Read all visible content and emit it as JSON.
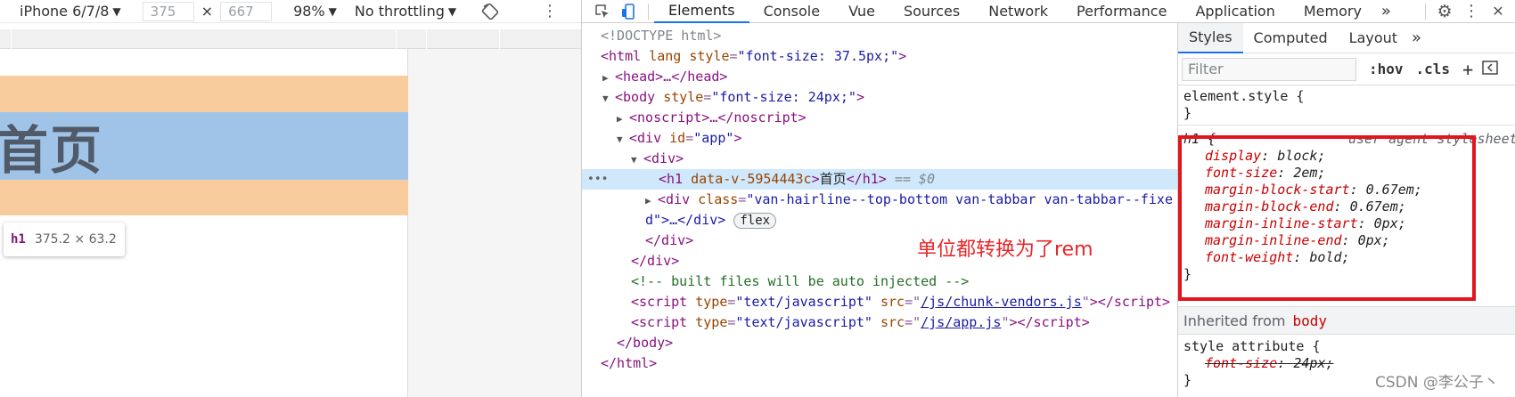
{
  "device_toolbar": {
    "device": "iPhone 6/7/8",
    "width": "375",
    "height": "667",
    "times": "×",
    "zoom": "98%",
    "throttling": "No throttling"
  },
  "viewport": {
    "h1_text": "首页",
    "tooltip_tag": "h1",
    "tooltip_size": "375.2 × 63.2"
  },
  "devtools_tabs": [
    "Elements",
    "Console",
    "Vue",
    "Sources",
    "Network",
    "Performance",
    "Application",
    "Memory"
  ],
  "devtools_more": "»",
  "tree": {
    "doctype": "<!DOCTYPE html>",
    "html_open": "<html",
    "html_attr_lang": "lang",
    "html_attr_style": "style",
    "html_style_val": "\"font-size: 37.5px;\"",
    "head": "<head>…</head>",
    "body_open": "<body",
    "body_attr_style": "style",
    "body_style_val": "\"font-size: 24px;\"",
    "noscript": "<noscript>…</noscript>",
    "div_app_open": "<div",
    "div_app_attr": "id",
    "div_app_val": "\"app\"",
    "div_inner": "<div>",
    "h1_open": "<h1",
    "h1_attr": "data-v-5954443c",
    "h1_text": "首页",
    "h1_close": "</h1>",
    "h1_eq": "== $0",
    "tabbar_open": "<div",
    "tabbar_attr": "class",
    "tabbar_val": "\"van-hairline--top-bottom van-tabbar van-tabbar--fixe",
    "tabbar_cont": "d\">…</div>",
    "tabbar_badge": "flex",
    "div_close1": "</div>",
    "div_close2": "</div>",
    "comment": "<!-- built files will be auto injected -->",
    "script1_src": "/js/chunk-vendors.js",
    "script2_src": "/js/app.js",
    "script_attr_type": "type",
    "script_type_val": "\"text/javascript\"",
    "script_attr_src": "src",
    "body_close": "</body>",
    "html_close": "</html>"
  },
  "annotation": "单位都转换为了rem",
  "styles": {
    "tabs": [
      "Styles",
      "Computed",
      "Layout"
    ],
    "more": "»",
    "filter_placeholder": "Filter",
    "hov": ":hov",
    "cls": ".cls",
    "element_style": "element.style {",
    "close_brace": "}",
    "h1_selector": "h1 {",
    "ua_label": "user agent stylesheet",
    "ua_props": [
      {
        "name": "display",
        "value": "block;"
      },
      {
        "name": "font-size",
        "value": "2em;"
      },
      {
        "name": "margin-block-start",
        "value": "0.67em;"
      },
      {
        "name": "margin-block-end",
        "value": "0.67em;"
      },
      {
        "name": "margin-inline-start",
        "value": "0px;"
      },
      {
        "name": "margin-inline-end",
        "value": "0px;"
      },
      {
        "name": "font-weight",
        "value": "bold;"
      }
    ],
    "inherited_from": "Inherited from",
    "inherited_tag": "body",
    "style_attr": "style attribute {",
    "style_attr_prop": "font-size",
    "style_attr_val": "24px;"
  },
  "watermark": "CSDN @李公子丶",
  "colors": {
    "margin": "#f9cc9d",
    "content": "#a0c4e8",
    "highlight_box": "#e3141c",
    "annotation": "#e8262a",
    "selection": "#cfe8fc",
    "active_tab": "#1a73e8"
  }
}
